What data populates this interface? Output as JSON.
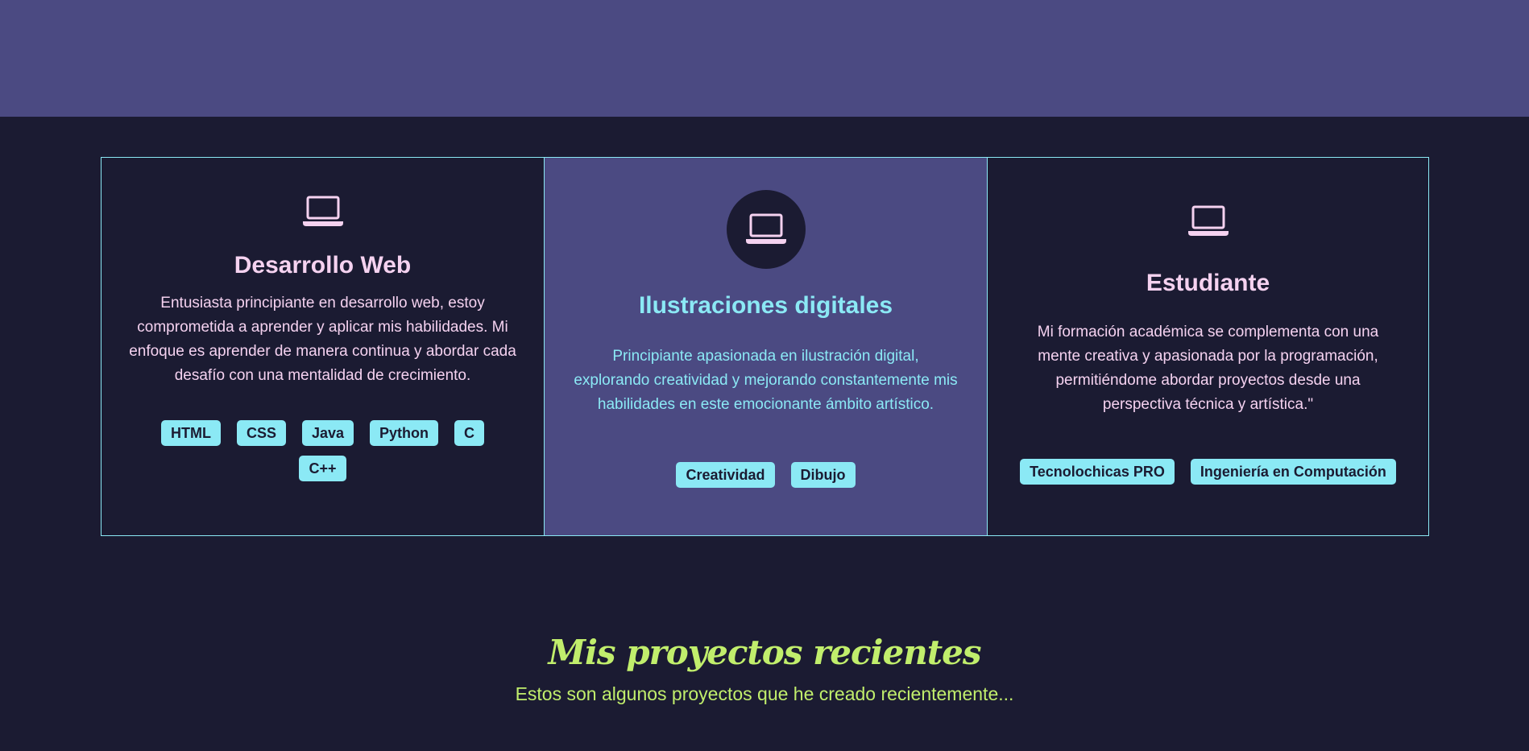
{
  "colors": {
    "page_bg": "#1b1b32",
    "band_bg": "#4b4a82",
    "accent_cyan": "#8be9f5",
    "text_pink": "#f5d2f0",
    "accent_green": "#c1ee6c"
  },
  "cards": [
    {
      "icon": "laptop-icon",
      "title": "Desarrollo Web",
      "text": "Entusiasta principiante en desarrollo web, estoy comprometida a aprender y aplicar mis habilidades. Mi enfoque es aprender de manera continua y abordar cada desafío con una mentalidad de crecimiento.",
      "tags": [
        "HTML",
        "CSS",
        "Java",
        "Python",
        "C",
        "C++"
      ]
    },
    {
      "icon": "laptop-icon",
      "title": "Ilustraciones digitales",
      "text": "Principiante apasionada en ilustración digital, explorando creatividad y mejorando constantemente mis habilidades en este emocionante ámbito artístico.",
      "tags": [
        "Creatividad",
        "Dibujo"
      ]
    },
    {
      "icon": "laptop-icon",
      "title": "Estudiante",
      "text": "Mi formación académica se complementa con una mente creativa y apasionada por la programación, permitiéndome abordar proyectos desde una perspectiva técnica y artística.\"",
      "tags": [
        "Tecnolochicas PRO",
        "Ingeniería en Computación"
      ]
    }
  ],
  "projects": {
    "title": "Mis proyectos recientes",
    "subtitle": "Estos son algunos proyectos que he creado recientemente..."
  }
}
